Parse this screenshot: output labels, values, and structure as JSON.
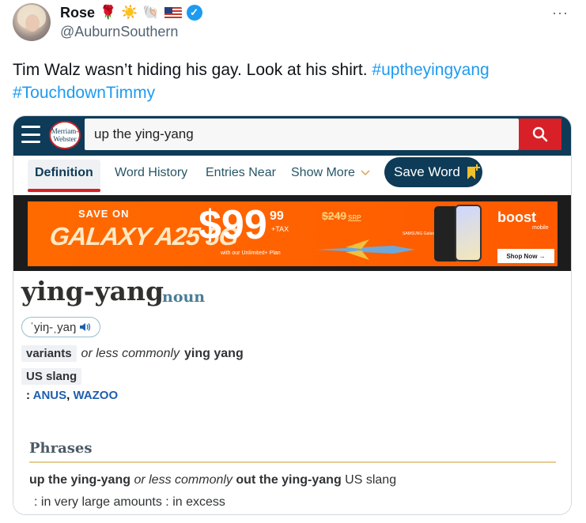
{
  "tweet": {
    "author_name": "Rose",
    "author_handle": "@AuburnSouthern",
    "name_emojis": [
      "🌹",
      "☀️",
      "🐚"
    ],
    "more_label": "···",
    "text": "Tim Walz wasn’t hiding his gay. Look at his shirt.",
    "hashtags": [
      "#uptheyingyang",
      "#TouchdownTimmy"
    ]
  },
  "dictionary": {
    "logo_top": "Merriam-",
    "logo_bottom": "Webster",
    "search_value": "up the ying-yang",
    "tabs": {
      "definition": "Definition",
      "word_history": "Word History",
      "entries_near": "Entries Near",
      "show_more": "Show More",
      "save_word": "Save Word"
    },
    "ad": {
      "save_on": "SAVE ON",
      "product": "GALAXY A25 5G",
      "price_dollars": "$99",
      "price_cents": "99",
      "price_tax": "+TAX",
      "plan_note": "with our Unlimited+ Plan",
      "srp": "$249",
      "srp_label": "SRP",
      "samsung": "SAMSUNG Galaxy A25 5G",
      "brand": "boost",
      "brand_sub": "mobile",
      "cta": "Shop Now →"
    },
    "entry": {
      "headword": "ying-yang",
      "part_of_speech": "noun",
      "pronunciation": "ˈyiŋ-ˌyaŋ",
      "variants_label": "variants",
      "variants_qualifier": "or less commonly",
      "variant_form": "ying yang",
      "usage_label": "US slang",
      "sense_prefix": ":",
      "synonyms": [
        "ANUS",
        "WAZOO"
      ],
      "phrases_heading": "Phrases",
      "phrase": "up the ying-yang",
      "phrase_qualifier": "or less commonly",
      "phrase_alt": "out the ying-yang",
      "phrase_label": "US slang",
      "phrase_def": ": in very large amounts : in excess"
    }
  },
  "colors": {
    "mw_navy": "#0e3b57",
    "mw_red": "#d72027",
    "hashtag_blue": "#1d9bf0",
    "ad_orange": "#ff6a00"
  }
}
